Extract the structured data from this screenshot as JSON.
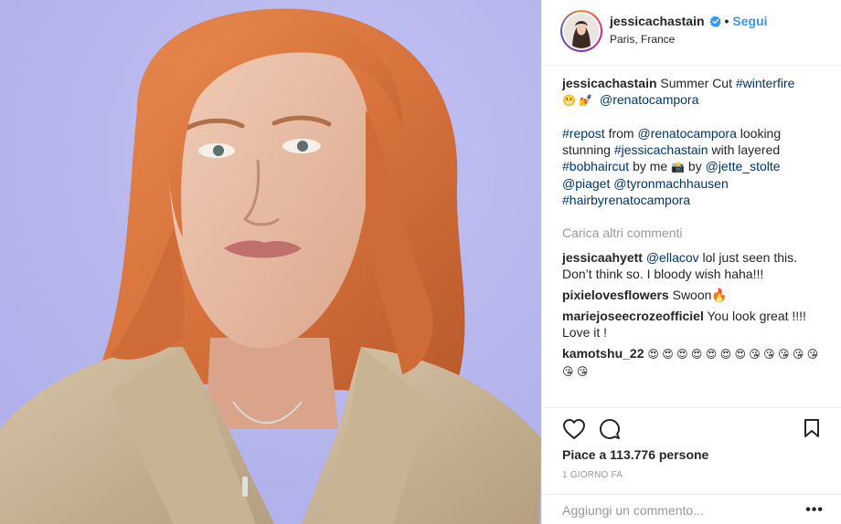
{
  "post": {
    "username": "jessicachastain",
    "follow_label": "Segui",
    "separator": "•",
    "location": "Paris, France",
    "verified_icon": "verified-badge-icon",
    "accent_color": "#3897f0"
  },
  "caption": {
    "username": "jessicachastain",
    "line1_text": "Summer Cut",
    "line1_tag": "#winterfire",
    "line2_emojis": "😬 💅",
    "line2_mention": "@renatocampora",
    "repost_tag": "#repost",
    "repost_from": "from",
    "repost_mention": "@renatocampora",
    "repost_text1": "looking stunning",
    "repost_tag2": "#jessicachastain",
    "repost_text2": "with layered",
    "repost_tag3": "#bobhaircut",
    "repost_text3": "by me",
    "repost_emoji": "📸",
    "repost_text4": "by",
    "repost_mention2": "@jette_stolte",
    "repost_mention3": "@piaget",
    "repost_mention4": "@tyronmachhausen",
    "repost_tag4": "#hairbyrenatocampora"
  },
  "load_more_label": "Carica altri commenti",
  "comments": [
    {
      "username": "jessicaahyett",
      "mention": "@ellacov",
      "text": "lol just seen this. Don’t think so. I bloody wish haha!!!"
    },
    {
      "username": "pixielovesflowers",
      "text": "Swoon🔥"
    },
    {
      "username": "mariejoseecrozeofficiel",
      "text": "You look great !!!! Love it !"
    },
    {
      "username": "kamotshu_22",
      "text": "😍 😍 😍 😍 😍 😍 😍 😘 😘 😘 😘 😘 😘 😘"
    }
  ],
  "actions": {
    "like_icon": "heart-icon",
    "comment_icon": "comment-bubble-icon",
    "save_icon": "bookmark-icon",
    "likes_text": "Piace a 113.776 persone",
    "time_text": "1 GIORNO FA"
  },
  "add_comment": {
    "placeholder": "Aggiungi un commento...",
    "more_label": "•••"
  }
}
